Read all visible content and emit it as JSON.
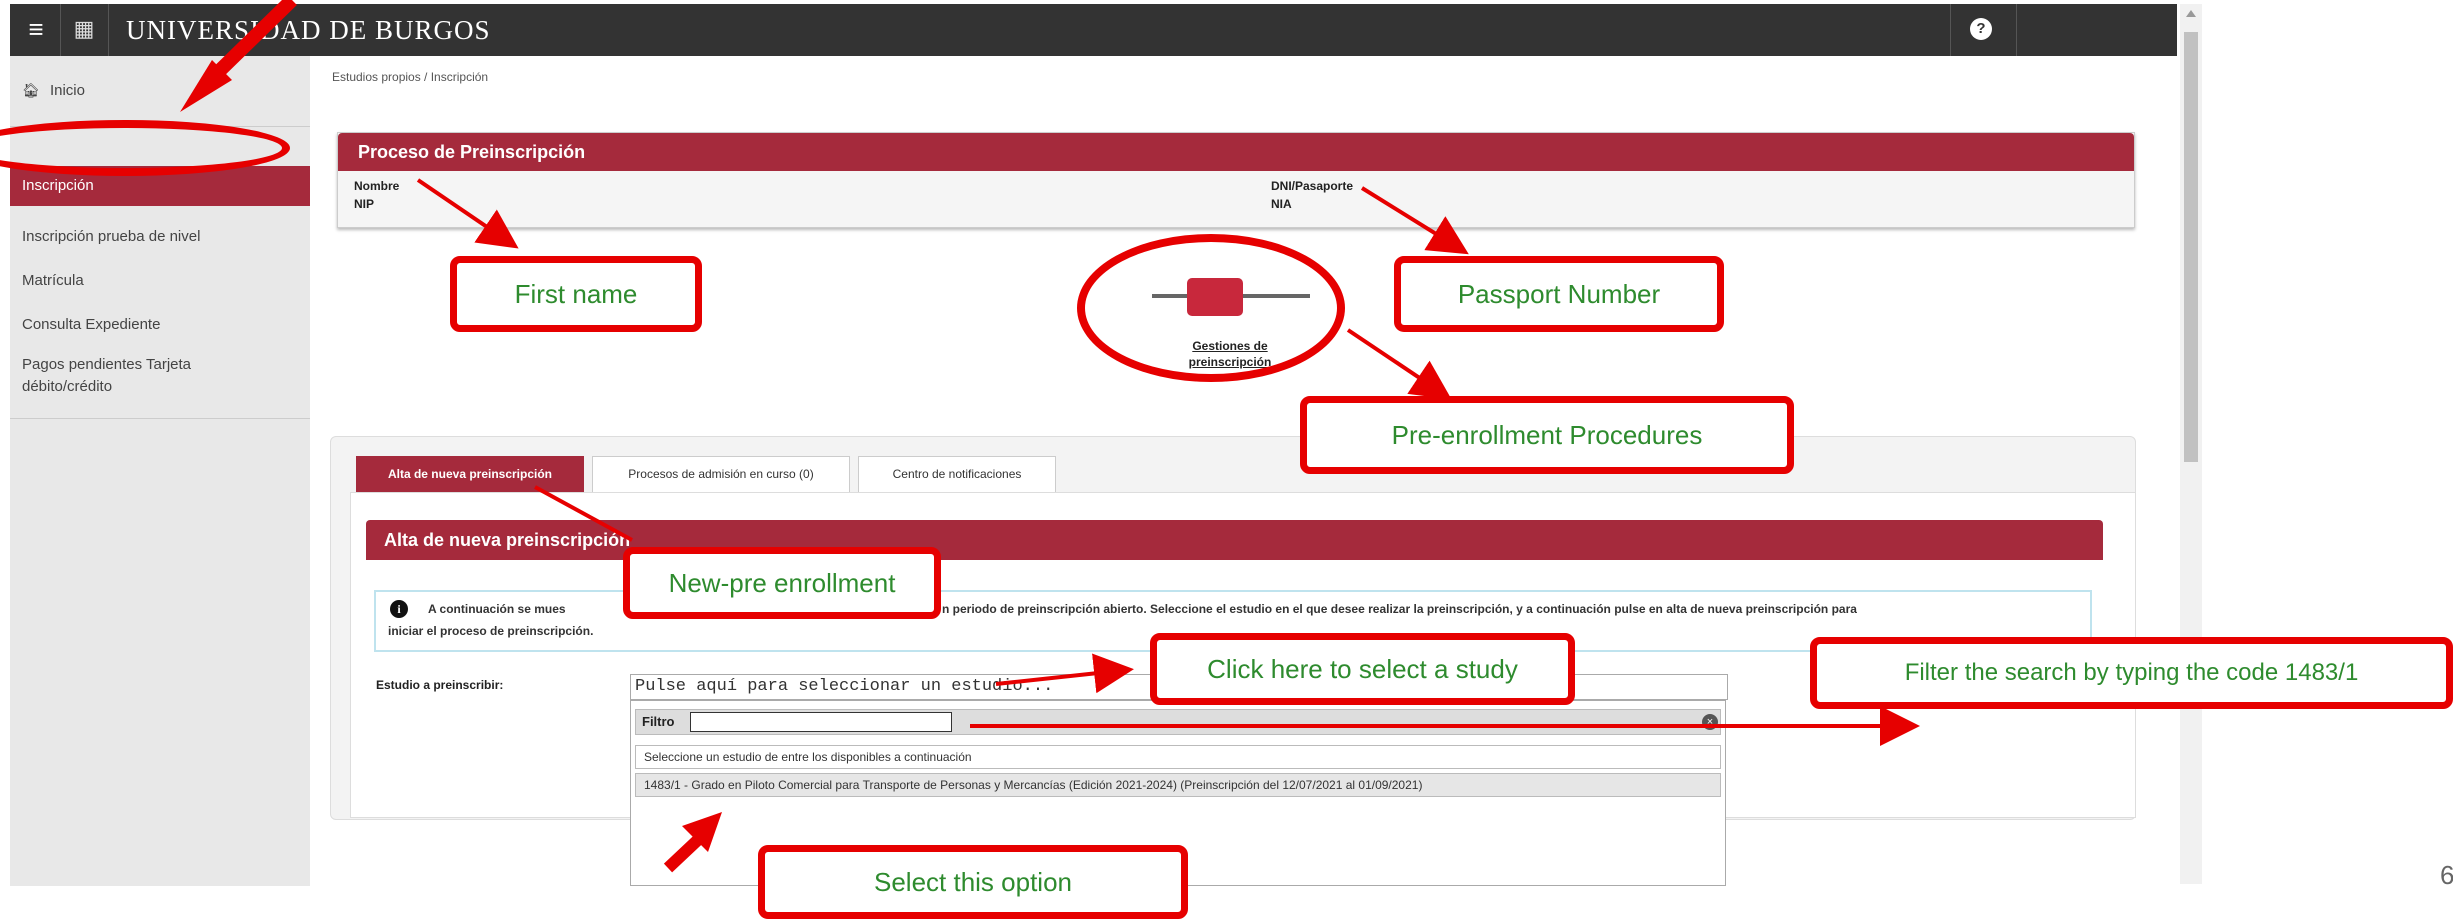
{
  "header": {
    "title": "UNIVERSIDAD DE BURGOS",
    "help_icon": "?"
  },
  "sidebar": {
    "items": [
      {
        "label": "Inicio",
        "icon": "home-icon"
      },
      {
        "label": "Inscripción",
        "active": true
      },
      {
        "label": "Inscripción prueba de nivel"
      },
      {
        "label": "Matrícula"
      },
      {
        "label": "Consulta Expediente"
      },
      {
        "label": "Pagos pendientes Tarjeta débito/crédito"
      }
    ]
  },
  "breadcrumb": "Estudios propios  /  Inscripción",
  "process": {
    "title": "Proceso de Preinscripción",
    "fields": {
      "nombre": "Nombre",
      "nip": "NIP",
      "dni": "DNI/Pasaporte",
      "nia": "NIA"
    }
  },
  "gestiones": {
    "line1": "Gestiones de",
    "line2": "preinscripción"
  },
  "tabs": [
    {
      "label": "Alta de nueva preinscripción",
      "active": true
    },
    {
      "label": "Procesos de admisión en curso (0)"
    },
    {
      "label": "Centro de notificaciones"
    }
  ],
  "alta": {
    "title": "Alta de nueva preinscripción",
    "info_left": "A continuación se mues",
    "info_right": "n periodo de preinscripción abierto. Seleccione el estudio en el que desee realizar la preinscripción, y a continuación pulse en alta de nueva preinscripción para",
    "info_line2": "iniciar el proceso de preinscripción.",
    "estudio_label": "Estudio a preinscribir:",
    "select_placeholder": "Pulse aquí para seleccionar un estudio...",
    "filter_label": "Filtro",
    "filter_value": "",
    "options": [
      "Seleccione un estudio de entre los disponibles a continuación",
      "1483/1 - Grado en Piloto Comercial para Transporte de Personas y Mercancías (Edición 2021-2024) (Preinscripción del 12/07/2021 al 01/09/2021)"
    ]
  },
  "callouts": {
    "first_name": "First name",
    "passport": "Passport Number",
    "pre_enrollment": "Pre-enrollment Procedures",
    "new_pre": "New-pre enrollment",
    "click_here": "Click here to select a study",
    "filter": "Filter the search by typing  the  code 1483/1",
    "select_option": "Select this option"
  },
  "page_number": "6",
  "colors": {
    "brand": "#a52a3c",
    "annotation": "#e60000",
    "callout_text": "#2e8b2e",
    "topbar": "#333333"
  }
}
